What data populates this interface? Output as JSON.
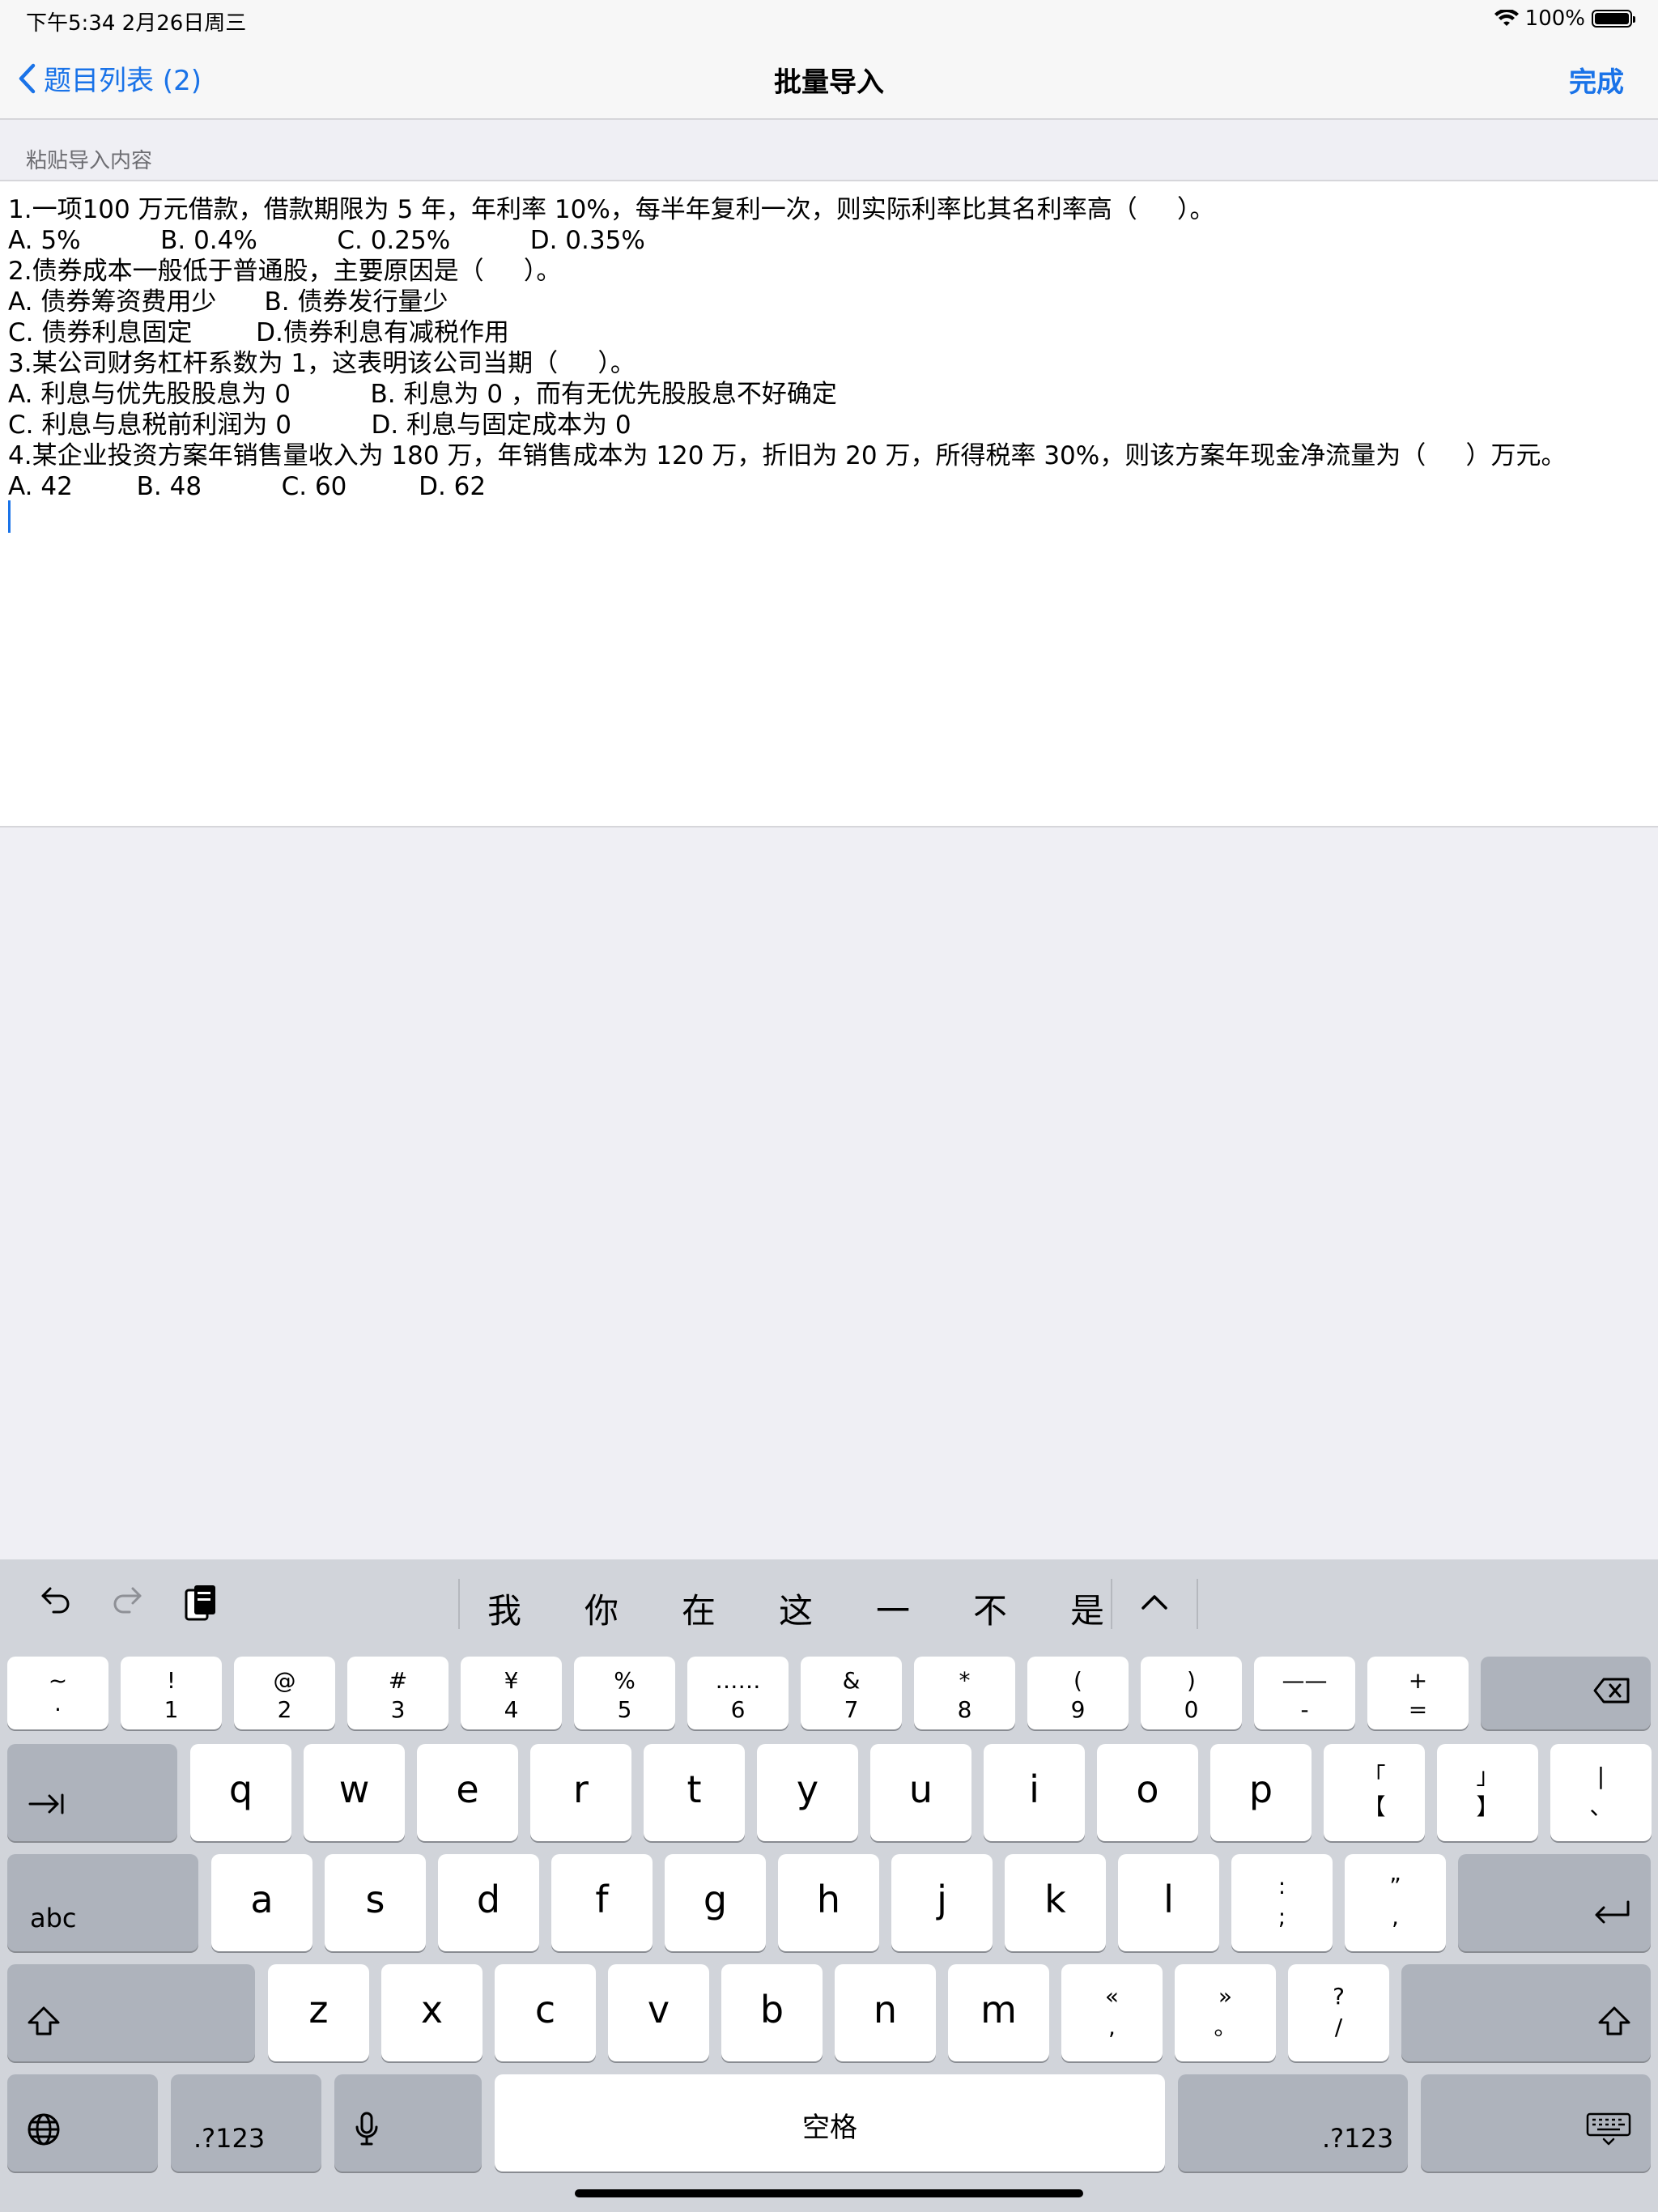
{
  "status_bar": {
    "time": "下午5:34  2月26日周三",
    "battery": "100%",
    "battery_level": 1.0
  },
  "nav": {
    "back_label": "题目列表 (2)",
    "title": "批量导入",
    "done_label": "完成"
  },
  "section": {
    "header": "粘贴导入内容"
  },
  "editor": {
    "lines": [
      "1.一项100 万元借款，借款期限为 5 年，年利率 10%，每半年复利一次，则实际利率比其名利率高（     ）。",
      "A. 5%          B. 0.4%          C. 0.25%          D. 0.35%",
      "2.债券成本一般低于普通股，主要原因是（     ）。",
      "A. 债券筹资费用少      B. 债券发行量少",
      "C. 债券利息固定        D.债券利息有减税作用",
      "3.某公司财务杠杆系数为 1，这表明该公司当期（     ）。",
      "A. 利息与优先股股息为 0          B. 利息为 0 ，而有无优先股股息不好确定",
      "C. 利息与息税前利润为 0          D. 利息与固定成本为 0",
      "4.某企业投资方案年销售量收入为 180 万，年销售成本为 120 万，折旧为 20 万，所得税率 30%，则该方案年现金净流量为（     ）万元。",
      "A. 42        B. 48          C. 60         D. 62"
    ]
  },
  "keyboard": {
    "candidates": [
      "我",
      "你",
      "在",
      "这",
      "一",
      "不",
      "是"
    ],
    "row1": [
      {
        "top": "~",
        "bot": "·"
      },
      {
        "top": "!",
        "bot": "1"
      },
      {
        "top": "@",
        "bot": "2"
      },
      {
        "top": "#",
        "bot": "3"
      },
      {
        "top": "¥",
        "bot": "4"
      },
      {
        "top": "%",
        "bot": "5"
      },
      {
        "top": "……",
        "bot": "6"
      },
      {
        "top": "&",
        "bot": "7"
      },
      {
        "top": "*",
        "bot": "8"
      },
      {
        "top": "(",
        "bot": "9"
      },
      {
        "top": ")",
        "bot": "0"
      },
      {
        "top": "——",
        "bot": "-"
      },
      {
        "top": "+",
        "bot": "="
      }
    ],
    "row2": [
      "q",
      "w",
      "e",
      "r",
      "t",
      "y",
      "u",
      "i",
      "o",
      "p"
    ],
    "row2_punct": [
      {
        "top": "「",
        "bot": "【"
      },
      {
        "top": "」",
        "bot": "】"
      },
      {
        "top": "|",
        "bot": "、"
      }
    ],
    "row3": [
      "a",
      "s",
      "d",
      "f",
      "g",
      "h",
      "j",
      "k",
      "l"
    ],
    "row3_punct": [
      {
        "top": ":",
        "bot": ";"
      },
      {
        "top": "”",
        "bot": ","
      }
    ],
    "row4": [
      "z",
      "x",
      "c",
      "v",
      "b",
      "n",
      "m"
    ],
    "row4_punct": [
      {
        "top": "«",
        "bot": ","
      },
      {
        "top": "»",
        "bot": "。"
      },
      {
        "top": "?",
        "bot": "/"
      }
    ],
    "abc_label": "abc",
    "num_label_left": ".?123",
    "num_label_right": ".?123",
    "space_label": "空格"
  }
}
